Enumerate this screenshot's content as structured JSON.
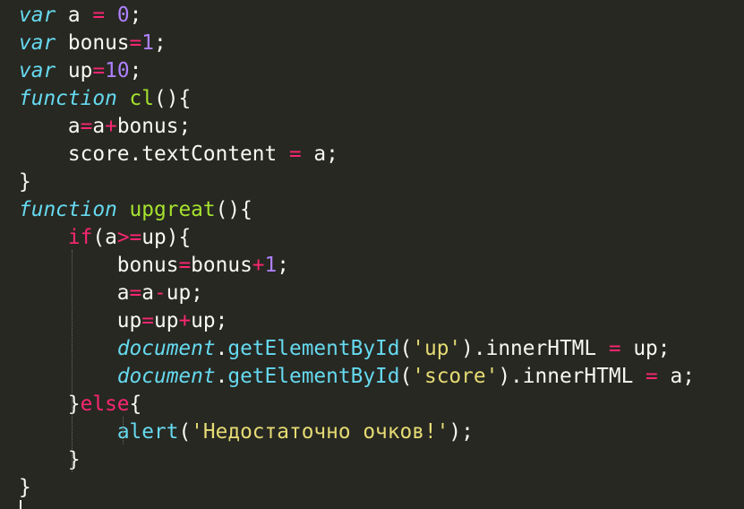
{
  "theme": {
    "background": "#272822",
    "text": "#f8f8f2",
    "keyword_italic": "#66d9ef",
    "keyword": "#f92672",
    "operator": "#f92672",
    "number": "#ae81ff",
    "function_name": "#a6e22e",
    "string": "#e6db74",
    "indent_guide": "#6b6b60"
  },
  "code": {
    "lines": [
      {
        "tokens": [
          {
            "t": "var",
            "k": "kwi"
          },
          {
            "t": " a ",
            "k": "plain"
          },
          {
            "t": "=",
            "k": "op"
          },
          {
            "t": " ",
            "k": "plain"
          },
          {
            "t": "0",
            "k": "num"
          },
          {
            "t": ";",
            "k": "plain"
          }
        ]
      },
      {
        "tokens": [
          {
            "t": "var",
            "k": "kwi"
          },
          {
            "t": " bonus",
            "k": "plain"
          },
          {
            "t": "=",
            "k": "op"
          },
          {
            "t": "1",
            "k": "num"
          },
          {
            "t": ";",
            "k": "plain"
          }
        ]
      },
      {
        "tokens": [
          {
            "t": "var",
            "k": "kwi"
          },
          {
            "t": " up",
            "k": "plain"
          },
          {
            "t": "=",
            "k": "op"
          },
          {
            "t": "10",
            "k": "num"
          },
          {
            "t": ";",
            "k": "plain"
          }
        ]
      },
      {
        "tokens": [
          {
            "t": "function",
            "k": "kwi"
          },
          {
            "t": " ",
            "k": "plain"
          },
          {
            "t": "cl",
            "k": "fn"
          },
          {
            "t": "(){",
            "k": "plain"
          }
        ]
      },
      {
        "tokens": [
          {
            "t": "    a",
            "k": "plain"
          },
          {
            "t": "=",
            "k": "op"
          },
          {
            "t": "a",
            "k": "plain"
          },
          {
            "t": "+",
            "k": "op"
          },
          {
            "t": "bonus;",
            "k": "plain"
          }
        ]
      },
      {
        "tokens": [
          {
            "t": "    score.textContent ",
            "k": "plain"
          },
          {
            "t": "=",
            "k": "op"
          },
          {
            "t": " a;",
            "k": "plain"
          }
        ]
      },
      {
        "tokens": [
          {
            "t": "}",
            "k": "plain"
          }
        ]
      },
      {
        "tokens": [
          {
            "t": "function",
            "k": "kwi"
          },
          {
            "t": " ",
            "k": "plain"
          },
          {
            "t": "upgreat",
            "k": "fn"
          },
          {
            "t": "(){",
            "k": "plain"
          }
        ]
      },
      {
        "tokens": [
          {
            "t": "    ",
            "k": "plain"
          },
          {
            "t": "if",
            "k": "kw"
          },
          {
            "t": "(a",
            "k": "plain"
          },
          {
            "t": ">=",
            "k": "op"
          },
          {
            "t": "up){",
            "k": "plain"
          }
        ]
      },
      {
        "tokens": [
          {
            "t": "        bonus",
            "k": "plain"
          },
          {
            "t": "=",
            "k": "op"
          },
          {
            "t": "bonus",
            "k": "plain"
          },
          {
            "t": "+",
            "k": "op"
          },
          {
            "t": "1",
            "k": "num"
          },
          {
            "t": ";",
            "k": "plain"
          }
        ]
      },
      {
        "tokens": [
          {
            "t": "        a",
            "k": "plain"
          },
          {
            "t": "=",
            "k": "op"
          },
          {
            "t": "a",
            "k": "plain"
          },
          {
            "t": "-",
            "k": "op"
          },
          {
            "t": "up;",
            "k": "plain"
          }
        ]
      },
      {
        "tokens": [
          {
            "t": "        up",
            "k": "plain"
          },
          {
            "t": "=",
            "k": "op"
          },
          {
            "t": "up",
            "k": "plain"
          },
          {
            "t": "+",
            "k": "op"
          },
          {
            "t": "up;",
            "k": "plain"
          }
        ]
      },
      {
        "tokens": [
          {
            "t": "        ",
            "k": "plain"
          },
          {
            "t": "document",
            "k": "kwi"
          },
          {
            "t": ".",
            "k": "plain"
          },
          {
            "t": "getElementById",
            "k": "kwn"
          },
          {
            "t": "(",
            "k": "plain"
          },
          {
            "t": "'up'",
            "k": "str"
          },
          {
            "t": ").innerHTML ",
            "k": "plain"
          },
          {
            "t": "=",
            "k": "op"
          },
          {
            "t": " up;",
            "k": "plain"
          }
        ]
      },
      {
        "tokens": [
          {
            "t": "        ",
            "k": "plain"
          },
          {
            "t": "document",
            "k": "kwi"
          },
          {
            "t": ".",
            "k": "plain"
          },
          {
            "t": "getElementById",
            "k": "kwn"
          },
          {
            "t": "(",
            "k": "plain"
          },
          {
            "t": "'score'",
            "k": "str"
          },
          {
            "t": ").innerHTML ",
            "k": "plain"
          },
          {
            "t": "=",
            "k": "op"
          },
          {
            "t": " a;",
            "k": "plain"
          }
        ]
      },
      {
        "tokens": [
          {
            "t": "    }",
            "k": "plain"
          },
          {
            "t": "else",
            "k": "kw"
          },
          {
            "t": "{",
            "k": "plain"
          }
        ]
      },
      {
        "tokens": [
          {
            "t": "        ",
            "k": "plain"
          },
          {
            "t": "alert",
            "k": "kwn"
          },
          {
            "t": "(",
            "k": "plain"
          },
          {
            "t": "'Недостаточно очков!'",
            "k": "str"
          },
          {
            "t": ");",
            "k": "plain"
          }
        ]
      },
      {
        "tokens": [
          {
            "t": "    }",
            "k": "plain"
          }
        ]
      },
      {
        "tokens": [
          {
            "t": "}",
            "k": "plain"
          }
        ]
      }
    ]
  }
}
